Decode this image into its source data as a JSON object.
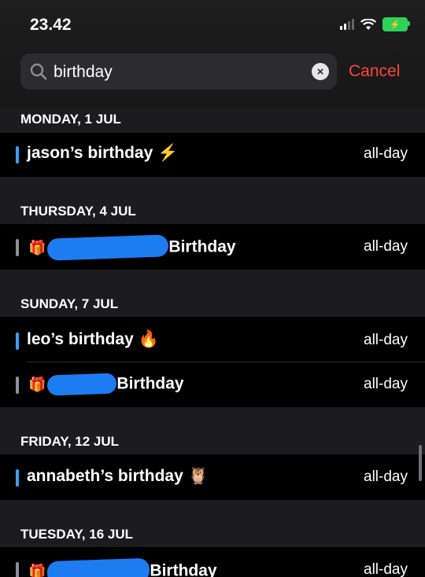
{
  "status": {
    "time": "23.42"
  },
  "search": {
    "query": "birthday",
    "cancel_label": "Cancel"
  },
  "sections": [
    {
      "date": "MONDAY, 1 JUL",
      "events": [
        {
          "title": "jason’s birthday ⚡",
          "tag": "all-day",
          "color": "#3aa0f3"
        }
      ]
    },
    {
      "date": "THURSDAY, 4 JUL",
      "events": [
        {
          "title": "Birthday",
          "tag": "all-day",
          "color": "#8e8e9a"
        }
      ]
    },
    {
      "date": "SUNDAY, 7 JUL",
      "events": [
        {
          "title": "leo’s birthday 🔥",
          "tag": "all-day",
          "color": "#3aa0f3"
        },
        {
          "title": "Birthday",
          "tag": "all-day",
          "color": "#8e8e9a"
        }
      ]
    },
    {
      "date": "FRIDAY, 12 JUL",
      "events": [
        {
          "title": "annabeth’s birthday 🦉",
          "tag": "all-day",
          "color": "#3aa0f3"
        }
      ]
    },
    {
      "date": "TUESDAY, 16 JUL",
      "events": [
        {
          "title": "Birthday",
          "tag": "all-day",
          "color": "#8e8e9a"
        }
      ]
    }
  ]
}
